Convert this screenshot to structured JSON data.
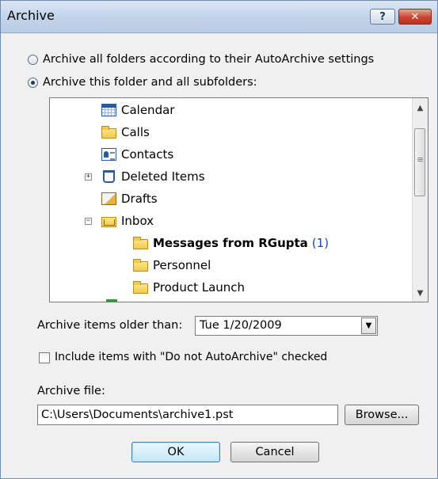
{
  "window": {
    "title": "Archive"
  },
  "titlebar": {
    "help_label": "?",
    "close_label": "✕"
  },
  "options": {
    "archive_all_label": "Archive all folders according to their AutoArchive settings",
    "archive_this_label": "Archive this folder and all subfolders:",
    "selected": "archive_this"
  },
  "tree": {
    "items": [
      {
        "label": "Calendar",
        "icon": "calendar-icon"
      },
      {
        "label": "Calls",
        "icon": "folder-icon"
      },
      {
        "label": "Contacts",
        "icon": "contacts-icon"
      },
      {
        "label": "Deleted Items",
        "icon": "deleted-items-icon",
        "expander": "+"
      },
      {
        "label": "Drafts",
        "icon": "drafts-icon"
      },
      {
        "label": "Inbox",
        "icon": "inbox-icon",
        "expander": "−"
      },
      {
        "label": "Messages from RGupta",
        "icon": "folder-icon",
        "count": "(1)",
        "bold": true
      },
      {
        "label": "Personnel",
        "icon": "folder-icon"
      },
      {
        "label": "Product Launch",
        "icon": "folder-icon"
      }
    ],
    "scroll_up": "▲",
    "scroll_down": "▼"
  },
  "archive_older": {
    "label": "Archive items older than:",
    "value": "Tue 1/20/2009",
    "dropdown_glyph": "▼"
  },
  "include_checkbox": {
    "label": "Include items with \"Do not AutoArchive\" checked",
    "checked": false
  },
  "archive_file": {
    "label": "Archive file:",
    "value": "C:\\Users\\Documents\\archive1.pst",
    "browse_label": "Browse..."
  },
  "footer": {
    "ok_label": "OK",
    "cancel_label": "Cancel"
  },
  "colors": {
    "title_bar": "#c4d5ea",
    "close_button": "#c9452f",
    "count_link": "#1f3fbf",
    "dialog_bg": "#f0f0f0"
  }
}
